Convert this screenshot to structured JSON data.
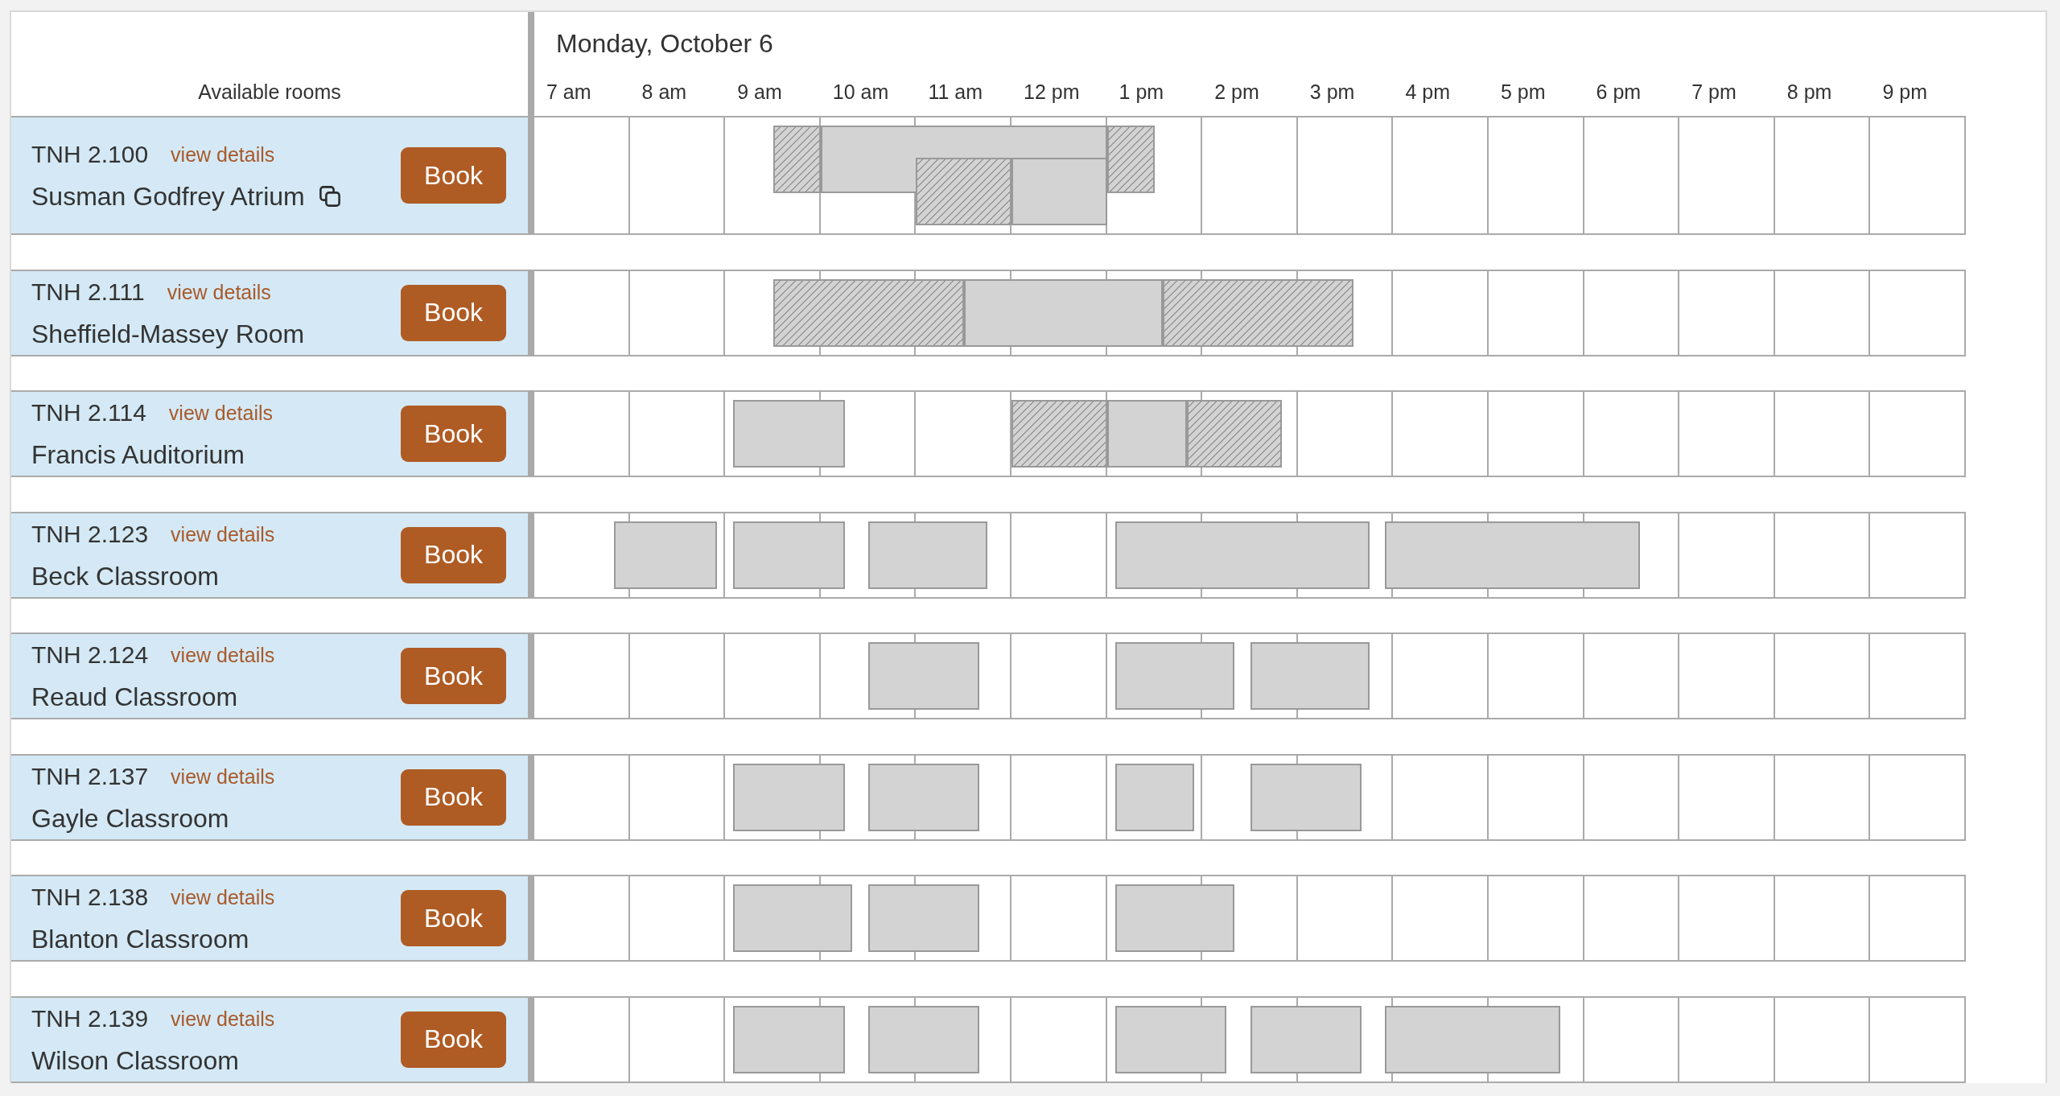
{
  "header": {
    "rooms_heading": "Available rooms",
    "date": "Monday, October 6",
    "hours": [
      "7 am",
      "8 am",
      "9 am",
      "10 am",
      "11 am",
      "12 pm",
      "1 pm",
      "2 pm",
      "3 pm",
      "4 pm",
      "5 pm",
      "6 pm",
      "7 pm",
      "8 pm",
      "9 pm"
    ]
  },
  "rooms": [
    {
      "number": "TNH 2.100",
      "details_link": "view details",
      "name": "Susman Godfrey Atrium",
      "copy_icon": true,
      "button": "Book",
      "events": [
        {
          "kind": "buffer",
          "start": {
            "level": 0.1667
          },
          "end": {
            "level": 0.2
          }
        },
        {
          "kind": "booking",
          "start": {
            "level": 0.2
          },
          "end": {
            "level": 0.4
          }
        },
        {
          "kind": "buffer",
          "start": {
            "level": 0.2667
          },
          "end": {
            "level": 0.3333
          }
        },
        {
          "kind": "booking",
          "start": {
            "level": 0.3333
          },
          "end": {
            "level": 0.4
          }
        },
        {
          "kind": "buffer",
          "start": {
            "level": 0.4
          },
          "end": {
            "level": 0.4333
          }
        }
      ]
    },
    {
      "number": "TNH 2.111",
      "details_link": "view details",
      "name": "Sheffield-Massey Room",
      "copy_icon": false,
      "button": "Book",
      "events": [
        {
          "kind": "buffer",
          "start": {
            "level": 0.1667
          },
          "end": {
            "level": 0.3
          }
        },
        {
          "kind": "booking",
          "start": {
            "level": 0.3
          },
          "end": {
            "level": 0.4389
          }
        },
        {
          "kind": "buffer",
          "start": {
            "level": 0.4389
          },
          "end": {
            "level": 0.5722
          }
        }
      ]
    },
    {
      "number": "TNH 2.114",
      "details_link": "view details",
      "name": "Francis Auditorium",
      "copy_icon": false,
      "button": "Book",
      "events": [
        {
          "kind": "booking",
          "start": {
            "level": 0.1389
          },
          "end": {
            "level": 0.2167
          }
        },
        {
          "kind": "buffer",
          "start": {
            "level": 0.3333
          },
          "end": {
            "level": 0.4
          }
        },
        {
          "kind": "booking",
          "start": {
            "level": 0.4
          },
          "end": {
            "level": 0.4556
          }
        },
        {
          "kind": "buffer",
          "start": {
            "level": 0.4556
          },
          "end": {
            "level": 0.5222
          }
        }
      ]
    },
    {
      "number": "TNH 2.123",
      "details_link": "view details",
      "name": "Beck Classroom",
      "copy_icon": false,
      "button": "Book",
      "events": [
        {
          "kind": "booking",
          "start": {
            "level": 0.0556
          },
          "end": {
            "level": 0.1278
          }
        },
        {
          "kind": "booking",
          "start": {
            "level": 0.1389
          },
          "end": {
            "level": 0.2167
          }
        },
        {
          "kind": "booking",
          "start": {
            "level": 0.2333
          },
          "end": {
            "level": 0.3167
          }
        },
        {
          "kind": "booking",
          "start": {
            "level": 0.4056
          },
          "end": {
            "level": 0.5833
          }
        },
        {
          "kind": "booking",
          "start": {
            "level": 0.5944
          },
          "end": {
            "level": 0.7722
          }
        }
      ]
    },
    {
      "number": "TNH 2.124",
      "details_link": "view details",
      "name": "Reaud Classroom",
      "copy_icon": false,
      "button": "Book",
      "events": [
        {
          "kind": "booking",
          "start": {
            "level": 0.2333
          },
          "end": {
            "level": 0.3111
          }
        },
        {
          "kind": "booking",
          "start": {
            "level": 0.4056
          },
          "end": {
            "level": 0.4889
          }
        },
        {
          "kind": "booking",
          "start": {
            "level": 0.5
          },
          "end": {
            "level": 0.5833
          }
        }
      ]
    },
    {
      "number": "TNH 2.137",
      "details_link": "view details",
      "name": "Gayle Classroom",
      "copy_icon": false,
      "button": "Book",
      "events": [
        {
          "kind": "booking",
          "start": {
            "level": 0.1389
          },
          "end": {
            "level": 0.2167
          }
        },
        {
          "kind": "booking",
          "start": {
            "level": 0.2333
          },
          "end": {
            "level": 0.3111
          }
        },
        {
          "kind": "booking",
          "start": {
            "level": 0.4056
          },
          "end": {
            "level": 0.4611
          }
        },
        {
          "kind": "booking",
          "start": {
            "level": 0.5
          },
          "end": {
            "level": 0.5778
          }
        }
      ]
    },
    {
      "number": "TNH 2.138",
      "details_link": "view details",
      "name": "Blanton Classroom",
      "copy_icon": false,
      "button": "Book",
      "events": [
        {
          "kind": "booking",
          "start": {
            "level": 0.1389
          },
          "end": {
            "level": 0.2222
          }
        },
        {
          "kind": "booking",
          "start": {
            "level": 0.2333
          },
          "end": {
            "level": 0.3111
          }
        },
        {
          "kind": "booking",
          "start": {
            "level": 0.4056
          },
          "end": {
            "level": 0.4889
          }
        }
      ]
    },
    {
      "number": "TNH 2.139",
      "details_link": "view details",
      "name": "Wilson Classroom",
      "copy_icon": false,
      "button": "Book",
      "events": [
        {
          "kind": "booking",
          "start": {
            "level": 0.1389
          },
          "end": {
            "level": 0.2167
          }
        },
        {
          "kind": "booking",
          "start": {
            "level": 0.2333
          },
          "end": {
            "level": 0.3111
          }
        },
        {
          "kind": "booking",
          "start": {
            "level": 0.4056
          },
          "end": {
            "level": 0.4833
          }
        },
        {
          "kind": "booking",
          "start": {
            "level": 0.5
          },
          "end": {
            "level": 0.5778
          }
        },
        {
          "kind": "booking",
          "start": {
            "level": 0.5944
          },
          "end": {
            "level": 0.7167
          }
        }
      ]
    }
  ]
}
